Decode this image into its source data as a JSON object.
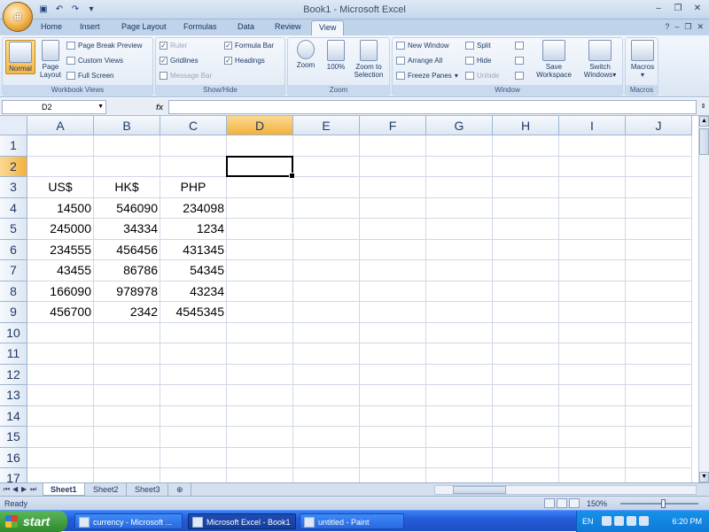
{
  "window": {
    "title": "Book1 - Microsoft Excel"
  },
  "quick_access": {
    "save_icon": "save-icon",
    "undo_icon": "undo-icon",
    "redo_icon": "redo-icon",
    "customize_icon": "customize-icon"
  },
  "tabs": [
    "Home",
    "Insert",
    "Page Layout",
    "Formulas",
    "Data",
    "Review",
    "View"
  ],
  "active_tab": "View",
  "ribbon": {
    "workbook_views": {
      "label": "Workbook Views",
      "normal": "Normal",
      "page_layout_1": "Page",
      "page_layout_2": "Layout",
      "page_break_preview": "Page Break Preview",
      "custom_views": "Custom Views",
      "full_screen": "Full Screen"
    },
    "show_hide": {
      "label": "Show/Hide",
      "ruler": "Ruler",
      "gridlines": "Gridlines",
      "message_bar": "Message Bar",
      "formula_bar": "Formula Bar",
      "headings": "Headings",
      "check": "✓"
    },
    "zoom": {
      "label": "Zoom",
      "zoom": "Zoom",
      "hundred": "100%",
      "zoom_to_selection_1": "Zoom to",
      "zoom_to_selection_2": "Selection"
    },
    "window": {
      "label": "Window",
      "new_window": "New Window",
      "arrange_all": "Arrange All",
      "freeze_panes": "Freeze Panes",
      "split": "Split",
      "hide": "Hide",
      "unhide": "Unhide",
      "save_workspace_1": "Save",
      "save_workspace_2": "Workspace",
      "switch_windows_1": "Switch",
      "switch_windows_2": "Windows"
    },
    "macros": {
      "label": "Macros",
      "macros": "Macros"
    }
  },
  "formula_bar": {
    "name_box": "D2",
    "fx": "fx",
    "formula": ""
  },
  "columns": [
    "A",
    "B",
    "C",
    "D",
    "E",
    "F",
    "G",
    "H",
    "I",
    "J"
  ],
  "rows": [
    "1",
    "2",
    "3",
    "4",
    "5",
    "6",
    "7",
    "8",
    "9",
    "10",
    "11",
    "12",
    "13",
    "14",
    "15",
    "16",
    "17"
  ],
  "selected_cell": "D2",
  "sheet": {
    "headers": [
      "US$",
      "HK$",
      "PHP"
    ],
    "data": [
      [
        "14500",
        "546090",
        "234098"
      ],
      [
        "245000",
        "34334",
        "1234"
      ],
      [
        "234555",
        "456456",
        "431345"
      ],
      [
        "43455",
        "86786",
        "54345"
      ],
      [
        "166090",
        "978978",
        "43234"
      ],
      [
        "456700",
        "2342",
        "4545345"
      ]
    ]
  },
  "sheet_tabs": [
    "Sheet1",
    "Sheet2",
    "Sheet3"
  ],
  "active_sheet": "Sheet1",
  "status": {
    "ready": "Ready",
    "zoom": "150%"
  },
  "taskbar": {
    "start": "start",
    "tasks": [
      {
        "label": "currency - Microsoft ...",
        "active": false
      },
      {
        "label": "Microsoft Excel - Book1",
        "active": true
      },
      {
        "label": "untitled - Paint",
        "active": false
      }
    ],
    "lang": "EN",
    "clock": "6:20 PM"
  }
}
